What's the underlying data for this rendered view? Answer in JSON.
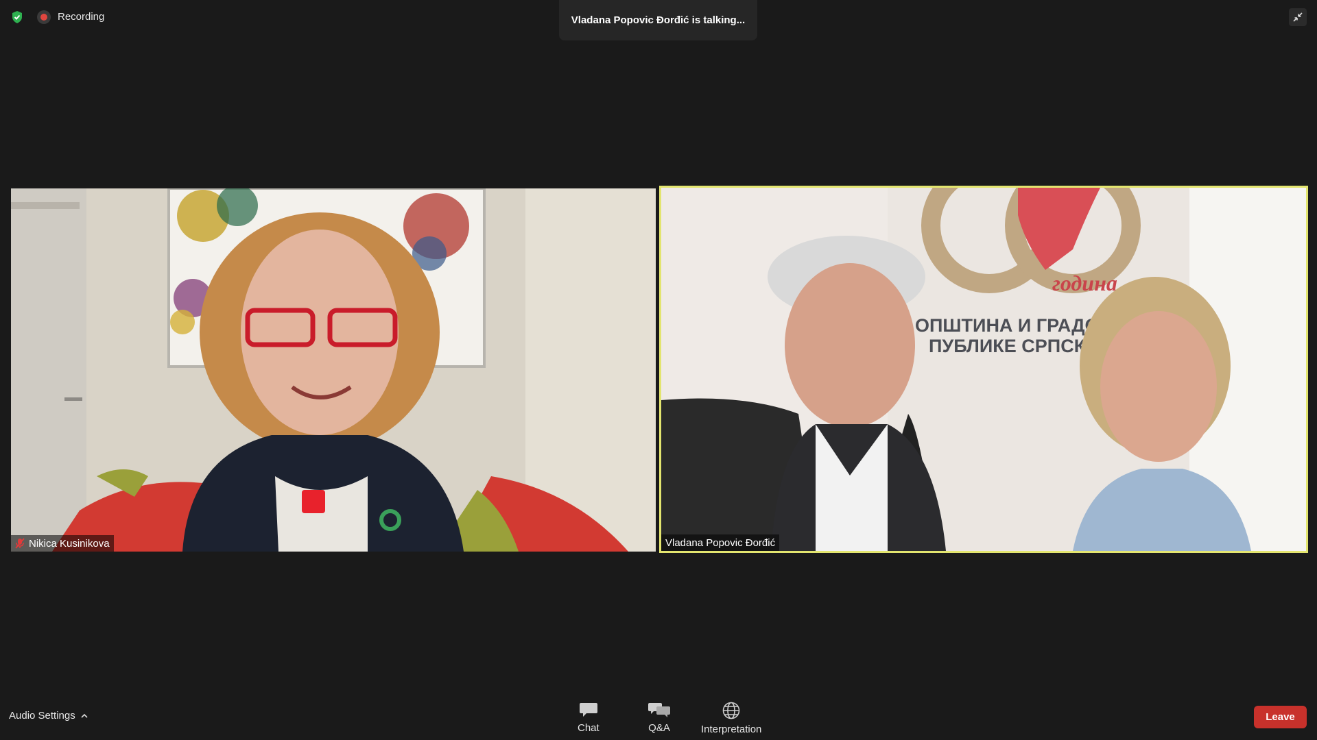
{
  "meeting": {
    "recording_label": "Recording",
    "talking_banner": "Vladana Popovic Đorđić is talking..."
  },
  "participants": [
    {
      "name": "Nikica Kusinikova",
      "muted": true,
      "active_speaker": false
    },
    {
      "name": "Vladana Popovic Đorđić",
      "muted": false,
      "active_speaker": true,
      "banner_text_line1": "ОПШТИНА И ГРАДОВА",
      "banner_text_line2": "ПУБЛИКЕ СРПСКЕ",
      "banner_logo_text": "година"
    }
  ],
  "toolbar": {
    "audio_settings_label": "Audio Settings",
    "chat_label": "Chat",
    "qa_label": "Q&A",
    "interpretation_label": "Interpretation",
    "leave_label": "Leave"
  },
  "colors": {
    "background": "#1a1a1a",
    "active_speaker_border": "#e3e56f",
    "leave": "#c8312b",
    "recording": "#e0463f",
    "secure": "#2eb150"
  }
}
